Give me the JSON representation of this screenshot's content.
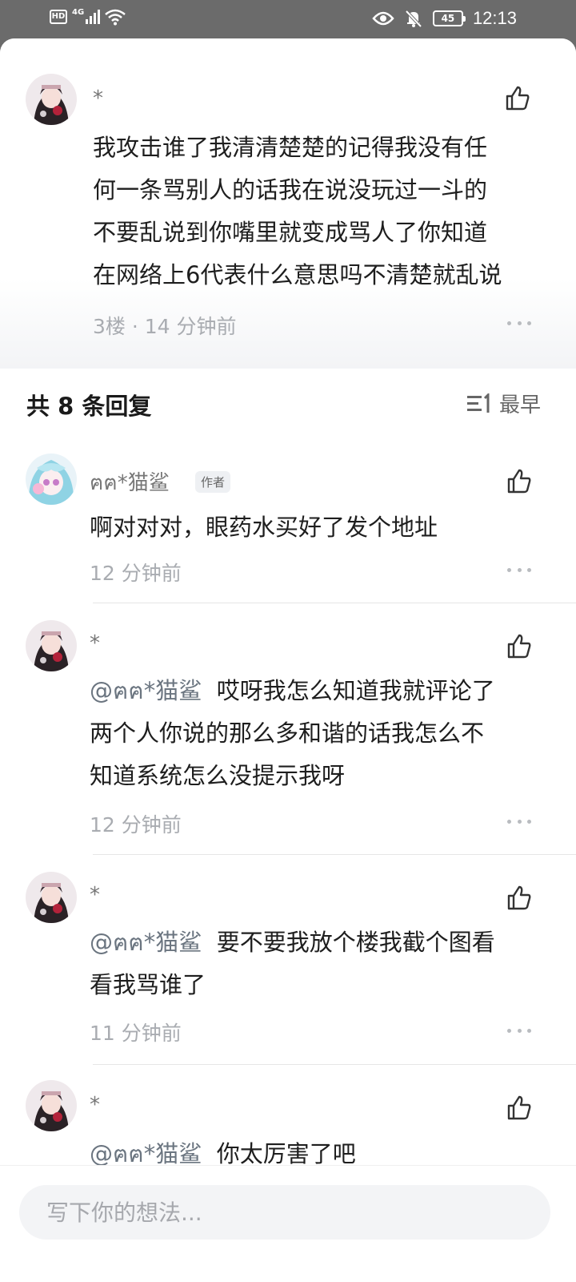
{
  "status_bar": {
    "hd": "HD",
    "network": "4G",
    "battery": "45",
    "time": "12:13"
  },
  "top_comment": {
    "username": "*",
    "lines": [
      "我攻击谁了我清清楚楚的记得我没有任",
      "何一条骂别人的话我在说没玩过一斗的",
      "不要乱说到你嘴里就变成骂人了你知道",
      "在网络上6代表什么意思吗不清楚就乱说"
    ],
    "meta": "3楼 · 14 分钟前"
  },
  "replies": {
    "header": "共 8 条回复",
    "sort_label": "最早"
  },
  "reply_items": [
    {
      "username": "ฅฅ*猫鲨",
      "author_tag": "作者",
      "mention": "",
      "lines": [
        "啊对对对，眼药水买好了发个地址"
      ],
      "meta": "12 分钟前"
    },
    {
      "username": "*",
      "mention": "@ฅฅ*猫鲨",
      "lines": [
        "哎呀我怎么知道我就评论了",
        "两个人你说的那么多和谐的话我怎么不",
        "知道系统怎么没提示我呀"
      ],
      "meta": "12 分钟前"
    },
    {
      "username": "*",
      "mention": "@ฅฅ*猫鲨",
      "lines": [
        "要不要我放个楼我截个图看",
        "看我骂谁了"
      ],
      "meta": "11 分钟前"
    },
    {
      "username": "*",
      "mention": "@ฅฅ*猫鲨",
      "lines": [
        "你太厉害了吧"
      ],
      "meta": ""
    }
  ],
  "input": {
    "placeholder": "写下你的想法..."
  },
  "colors": {
    "status_bar_bg": "#6b6b6b",
    "meta_text": "#a9acb1",
    "mention": "#6b7580",
    "input_bg": "#f3f4f6"
  }
}
